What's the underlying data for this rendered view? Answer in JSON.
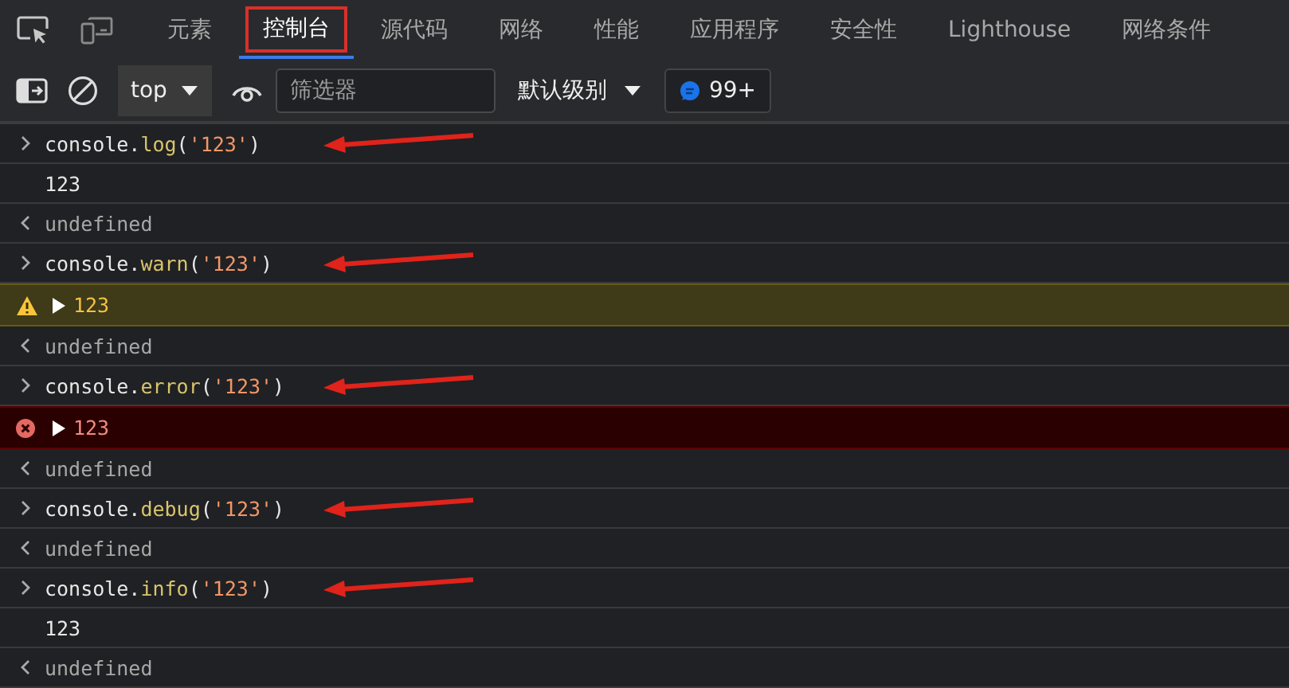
{
  "tabs": [
    {
      "label": "元素",
      "selected": false,
      "highlighted": false
    },
    {
      "label": "控制台",
      "selected": true,
      "highlighted": true
    },
    {
      "label": "源代码",
      "selected": false,
      "highlighted": false
    },
    {
      "label": "网络",
      "selected": false,
      "highlighted": false
    },
    {
      "label": "性能",
      "selected": false,
      "highlighted": false
    },
    {
      "label": "应用程序",
      "selected": false,
      "highlighted": false
    },
    {
      "label": "安全性",
      "selected": false,
      "highlighted": false
    },
    {
      "label": "Lighthouse",
      "selected": false,
      "highlighted": false
    },
    {
      "label": "网络条件",
      "selected": false,
      "highlighted": false
    }
  ],
  "toolbar": {
    "context": "top",
    "filter": {
      "placeholder": "筛选器"
    },
    "levels": "默认级别",
    "issues": "99+"
  },
  "console": [
    {
      "kind": "input",
      "arrow": true,
      "tokens": [
        {
          "kind": "plain",
          "text": "console."
        },
        {
          "kind": "method",
          "text": "log"
        },
        {
          "kind": "plain",
          "text": "("
        },
        {
          "kind": "string",
          "text": "'123'"
        },
        {
          "kind": "plain",
          "text": ")"
        }
      ]
    },
    {
      "kind": "log",
      "text": "123"
    },
    {
      "kind": "result",
      "text": "undefined"
    },
    {
      "kind": "input",
      "arrow": true,
      "tokens": [
        {
          "kind": "plain",
          "text": "console."
        },
        {
          "kind": "method",
          "text": "warn"
        },
        {
          "kind": "plain",
          "text": "("
        },
        {
          "kind": "string",
          "text": "'123'"
        },
        {
          "kind": "plain",
          "text": ")"
        }
      ]
    },
    {
      "kind": "warning",
      "text": "123"
    },
    {
      "kind": "result",
      "text": "undefined"
    },
    {
      "kind": "input",
      "arrow": true,
      "tokens": [
        {
          "kind": "plain",
          "text": "console."
        },
        {
          "kind": "method",
          "text": "error"
        },
        {
          "kind": "plain",
          "text": "("
        },
        {
          "kind": "string",
          "text": "'123'"
        },
        {
          "kind": "plain",
          "text": ")"
        }
      ]
    },
    {
      "kind": "error",
      "text": "123"
    },
    {
      "kind": "result",
      "text": "undefined"
    },
    {
      "kind": "input",
      "arrow": true,
      "tokens": [
        {
          "kind": "plain",
          "text": "console."
        },
        {
          "kind": "method",
          "text": "debug"
        },
        {
          "kind": "plain",
          "text": "("
        },
        {
          "kind": "string",
          "text": "'123'"
        },
        {
          "kind": "plain",
          "text": ")"
        }
      ]
    },
    {
      "kind": "result",
      "text": "undefined"
    },
    {
      "kind": "input",
      "arrow": true,
      "tokens": [
        {
          "kind": "plain",
          "text": "console."
        },
        {
          "kind": "method",
          "text": "info"
        },
        {
          "kind": "plain",
          "text": "("
        },
        {
          "kind": "string",
          "text": "'123'"
        },
        {
          "kind": "plain",
          "text": ")"
        }
      ]
    },
    {
      "kind": "log",
      "text": "123"
    },
    {
      "kind": "result",
      "text": "undefined"
    }
  ]
}
